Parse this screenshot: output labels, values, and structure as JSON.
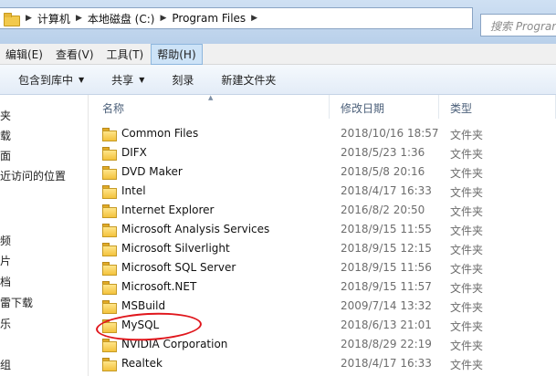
{
  "breadcrumb": [
    "计算机",
    "本地磁盘 (C:)",
    "Program Files"
  ],
  "search": {
    "placeholder": "搜索 Program Files"
  },
  "menu": [
    {
      "label": "编辑(E)",
      "active": false
    },
    {
      "label": "查看(V)",
      "active": false
    },
    {
      "label": "工具(T)",
      "active": false
    },
    {
      "label": "帮助(H)",
      "active": true
    }
  ],
  "toolbar": {
    "include_library": "包含到库中",
    "share": "共享",
    "burn": "刻录",
    "new_folder": "新建文件夹"
  },
  "nav_items": [
    "夹",
    "载",
    "面",
    "近访问的位置",
    "频",
    "片",
    "档",
    "雷下载",
    "乐",
    "组"
  ],
  "columns": {
    "name": "名称",
    "date": "修改日期",
    "type": "类型"
  },
  "files": [
    {
      "name": "Common Files",
      "date": "2018/10/16 18:57",
      "type": "文件夹"
    },
    {
      "name": "DIFX",
      "date": "2018/5/23 1:36",
      "type": "文件夹"
    },
    {
      "name": "DVD Maker",
      "date": "2018/5/8 20:16",
      "type": "文件夹"
    },
    {
      "name": "Intel",
      "date": "2018/4/17 16:33",
      "type": "文件夹"
    },
    {
      "name": "Internet Explorer",
      "date": "2016/8/2 20:50",
      "type": "文件夹"
    },
    {
      "name": "Microsoft Analysis Services",
      "date": "2018/9/15 11:55",
      "type": "文件夹"
    },
    {
      "name": "Microsoft Silverlight",
      "date": "2018/9/15 12:15",
      "type": "文件夹"
    },
    {
      "name": "Microsoft SQL Server",
      "date": "2018/9/15 11:56",
      "type": "文件夹"
    },
    {
      "name": "Microsoft.NET",
      "date": "2018/9/15 11:57",
      "type": "文件夹"
    },
    {
      "name": "MSBuild",
      "date": "2009/7/14 13:32",
      "type": "文件夹"
    },
    {
      "name": "MySQL",
      "date": "2018/6/13 21:01",
      "type": "文件夹"
    },
    {
      "name": "NVIDIA Corporation",
      "date": "2018/8/29 22:19",
      "type": "文件夹"
    },
    {
      "name": "Realtek",
      "date": "2018/4/17 16:33",
      "type": "文件夹"
    }
  ],
  "annotation": {
    "circled_item": "MySQL",
    "color": "#e0161c"
  }
}
